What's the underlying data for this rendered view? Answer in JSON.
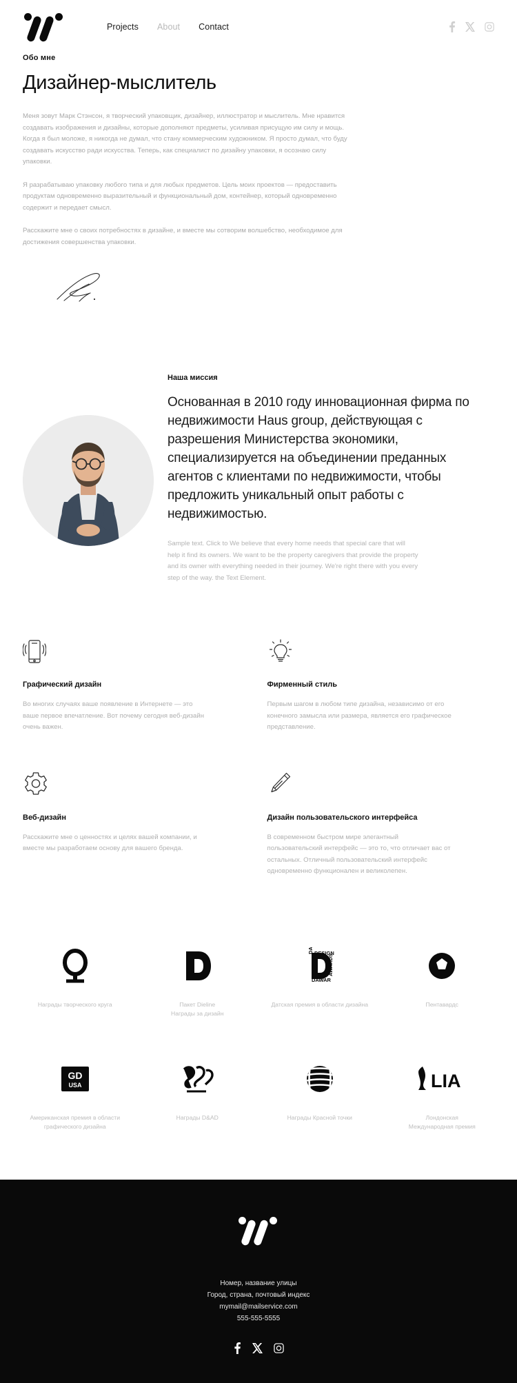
{
  "header": {
    "logo_name": "studio-logo",
    "nav": [
      {
        "label": "Projects",
        "muted": false
      },
      {
        "label": "About",
        "muted": true
      },
      {
        "label": "Contact",
        "muted": false
      }
    ],
    "social": [
      {
        "name": "facebook-icon"
      },
      {
        "name": "x-twitter-icon"
      },
      {
        "name": "instagram-icon"
      }
    ]
  },
  "about": {
    "eyebrow": "Обо мне",
    "title": "Дизайнер-мыслитель",
    "paragraphs": [
      "Меня зовут Марк Стэнсон, я творческий упаковщик, дизайнер, иллюстратор и мыслитель. Мне нравится создавать изображения и дизайны, которые дополняют предметы, усиливая присущую им силу и мощь. Когда я был моложе, я никогда не думал, что стану коммерческим художником. Я просто думал, что буду создавать искусство ради искусства. Теперь, как специалист по дизайну упаковки, я осознаю силу упаковки.",
      "Я разрабатываю упаковку любого типа и для любых предметов. Цель моих проектов — предоставить продуктам одновременно выразительный и функциональный дом, контейнер, который одновременно содержит и передает смысл.",
      "Расскажите мне о своих потребностях в дизайне, и вместе мы сотворим волшебство, необходимое для достижения совершенства упаковки."
    ],
    "signature_name": "signature-mark"
  },
  "mission": {
    "eyebrow": "Наша миссия",
    "heading": "Основанная в 2010 году инновационная фирма по недвижимости Haus group, действующая с разрешения Министерства экономики, специализируется на объединении преданных агентов с клиентами по недвижимости, чтобы предложить уникальный опыт работы с недвижимостью.",
    "subtext": "Sample text. Click to We believe that every home needs that special care that will help it find its owners. We want to be the property caregivers that provide the property and its owner with everything needed in their journey. We're right there with you every step of the way. the Text Element.",
    "portrait_name": "portrait-photo"
  },
  "services": [
    {
      "icon": "vibrating-phone-icon",
      "title": "Графический дизайн",
      "text": "Во многих случаях ваше появление в Интернете — это ваше первое впечатление. Вот почему сегодня веб-дизайн очень важен."
    },
    {
      "icon": "lightbulb-icon",
      "title": "Фирменный стиль",
      "text": "Первым шагом в любом типе дизайна, независимо от его конечного замысла или размера, является его графическое представление."
    },
    {
      "icon": "gear-icon",
      "title": "Веб-дизайн",
      "text": "Расскажите мне о ценностях и целях вашей компании, и вместе мы разработаем основу для вашего бренда."
    },
    {
      "icon": "pencil-icon",
      "title": "Дизайн пользовательского интерфейса",
      "text": "В современном быстром мире элегантный пользовательский интерфейс — это то, что отличает вас от остальных. Отличный пользовательский интерфейс одновременно функционален и великолепен."
    }
  ],
  "awards": [
    {
      "logo": "creative-circle-logo",
      "name": "Награды творческого круга"
    },
    {
      "logo": "dieline-d-logo",
      "name": "Пакет Dieline\nНаграды за дизайн"
    },
    {
      "logo": "danish-design-awards-logo",
      "name": "Датская премия в области дизайна"
    },
    {
      "logo": "pentawards-logo",
      "name": "Пентавардс"
    },
    {
      "logo": "gd-usa-logo",
      "name": "Американская премия в области графического дизайна"
    },
    {
      "logo": "dand-ad-logo",
      "name": "Награды D&AD"
    },
    {
      "logo": "red-dot-logo",
      "name": "Награды Красной точки"
    },
    {
      "logo": "lia-logo",
      "name": "Лондонская\nМеждународная премия"
    }
  ],
  "footer": {
    "logo_name": "studio-logo-footer",
    "lines": [
      "Номер, название улицы",
      "Город, страна, почтовый индекс",
      "mymail@mailservice.com",
      "555-555-5555"
    ],
    "social": [
      {
        "name": "facebook-icon"
      },
      {
        "name": "x-twitter-icon"
      },
      {
        "name": "instagram-icon"
      }
    ]
  },
  "colors": {
    "background": "#ffffff",
    "text": "#111111",
    "muted": "#b0b0b0",
    "footer_bg": "#0a0a0a"
  }
}
